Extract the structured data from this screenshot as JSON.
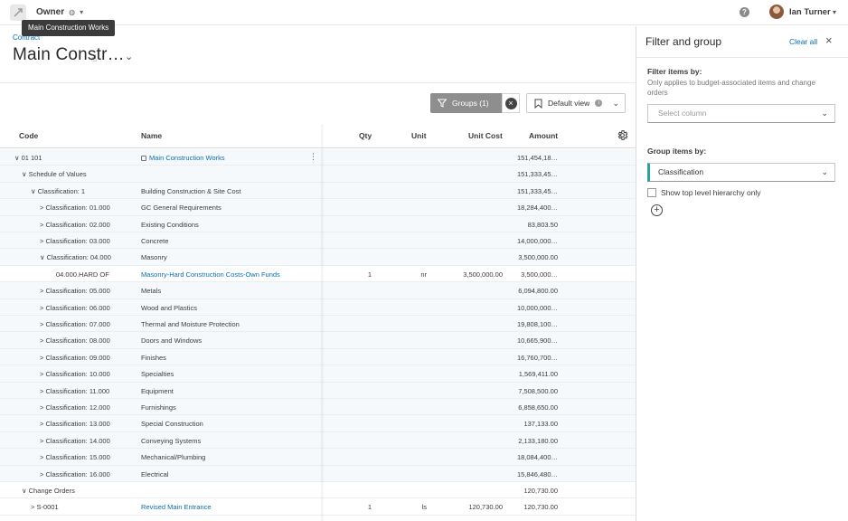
{
  "topbar": {
    "role_label": "Owner",
    "user_name": "Ian Turner"
  },
  "tooltip": {
    "text": "Main Construction Works"
  },
  "breadcrumb": {
    "text": "Contract"
  },
  "page": {
    "title": "Main Constr…"
  },
  "toolbar": {
    "groups_label": "Groups (1)",
    "view_label": "Default view"
  },
  "table": {
    "headers": {
      "code": "Code",
      "name": "Name",
      "qty": "Qty",
      "unit": "Unit",
      "unit_cost": "Unit Cost",
      "amount": "Amount"
    },
    "rows": [
      {
        "code": "∨ 01 101",
        "name": "Main Construction Works",
        "qty": "",
        "unit": "",
        "unit_cost": "",
        "amount": "151,454,18…",
        "indent": 0,
        "link": true,
        "locked": true,
        "kebab": true
      },
      {
        "code": "∨ Schedule of Values",
        "name": "",
        "qty": "",
        "unit": "",
        "unit_cost": "",
        "amount": "151,333,45…",
        "indent": 1
      },
      {
        "code": "∨ Classification: 1",
        "name": "Building Construction & Site Cost",
        "qty": "",
        "unit": "",
        "unit_cost": "",
        "amount": "151,333,45…",
        "indent": 2
      },
      {
        "code": "> Classification: 01.000",
        "name": "GC General Requirements",
        "qty": "",
        "unit": "",
        "unit_cost": "",
        "amount": "18,284,400…",
        "indent": 3
      },
      {
        "code": "> Classification: 02.000",
        "name": "Existing Conditions",
        "qty": "",
        "unit": "",
        "unit_cost": "",
        "amount": "83,803.50",
        "indent": 3
      },
      {
        "code": "> Classification: 03.000",
        "name": "Concrete",
        "qty": "",
        "unit": "",
        "unit_cost": "",
        "amount": "14,000,000…",
        "indent": 3
      },
      {
        "code": "∨ Classification: 04.000",
        "name": "Masonry",
        "qty": "",
        "unit": "",
        "unit_cost": "",
        "amount": "3,500,000.00",
        "indent": 3
      },
      {
        "code": "04.000.HARD OF",
        "name": "Masonry-Hard Construction Costs-Own Funds",
        "qty": "1",
        "unit": "nr",
        "unit_cost": "3,500,000.00",
        "amount": "3,500,000…",
        "indent": 5,
        "link": true,
        "white": true
      },
      {
        "code": "> Classification: 05.000",
        "name": "Metals",
        "qty": "",
        "unit": "",
        "unit_cost": "",
        "amount": "6,094,800.00",
        "indent": 3
      },
      {
        "code": "> Classification: 06.000",
        "name": "Wood and Plastics",
        "qty": "",
        "unit": "",
        "unit_cost": "",
        "amount": "10,000,000…",
        "indent": 3
      },
      {
        "code": "> Classification: 07.000",
        "name": "Thermal and Moisture Protection",
        "qty": "",
        "unit": "",
        "unit_cost": "",
        "amount": "19,808,100…",
        "indent": 3
      },
      {
        "code": "> Classification: 08.000",
        "name": "Doors and Windows",
        "qty": "",
        "unit": "",
        "unit_cost": "",
        "amount": "10,665,900…",
        "indent": 3
      },
      {
        "code": "> Classification: 09.000",
        "name": "Finishes",
        "qty": "",
        "unit": "",
        "unit_cost": "",
        "amount": "16,760,700…",
        "indent": 3
      },
      {
        "code": "> Classification: 10.000",
        "name": "Specialties",
        "qty": "",
        "unit": "",
        "unit_cost": "",
        "amount": "1,569,411.00",
        "indent": 3
      },
      {
        "code": "> Classification: 11.000",
        "name": "Equipment",
        "qty": "",
        "unit": "",
        "unit_cost": "",
        "amount": "7,508,500.00",
        "indent": 3
      },
      {
        "code": "> Classification: 12.000",
        "name": "Furnishings",
        "qty": "",
        "unit": "",
        "unit_cost": "",
        "amount": "6,858,650.00",
        "indent": 3
      },
      {
        "code": "> Classification: 13.000",
        "name": "Special Construction",
        "qty": "",
        "unit": "",
        "unit_cost": "",
        "amount": "137,133.00",
        "indent": 3
      },
      {
        "code": "> Classification: 14.000",
        "name": "Conveying Systems",
        "qty": "",
        "unit": "",
        "unit_cost": "",
        "amount": "2,133,180.00",
        "indent": 3
      },
      {
        "code": "> Classification: 15.000",
        "name": "Mechanical/Plumbing",
        "qty": "",
        "unit": "",
        "unit_cost": "",
        "amount": "18,084,400…",
        "indent": 3
      },
      {
        "code": "> Classification: 16.000",
        "name": "Electrical",
        "qty": "",
        "unit": "",
        "unit_cost": "",
        "amount": "15,846,480…",
        "indent": 3
      },
      {
        "code": "∨ Change Orders",
        "name": "",
        "qty": "",
        "unit": "",
        "unit_cost": "",
        "amount": "120,730.00",
        "indent": 1,
        "white": true
      },
      {
        "code": "> S-0001",
        "name": "Revised Main Entrance",
        "qty": "1",
        "unit": "ls",
        "unit_cost": "120,730.00",
        "amount": "120,730.00",
        "indent": 2,
        "link": true,
        "white": true
      }
    ]
  },
  "panel": {
    "title": "Filter and group",
    "clear_all": "Clear all",
    "filter_label": "Filter items by:",
    "filter_hint": "Only applies to budget-associated items and change orders",
    "filter_placeholder": "Select column",
    "group_label": "Group items by:",
    "group_value": "Classification",
    "checkbox_label": "Show top level hierarchy only"
  },
  "colors": {
    "accent": "#0a6fb0",
    "selected_bar": "#2aa3a3",
    "groups_bg": "#8e8e8e",
    "row_alt": "#f5f9fc"
  }
}
